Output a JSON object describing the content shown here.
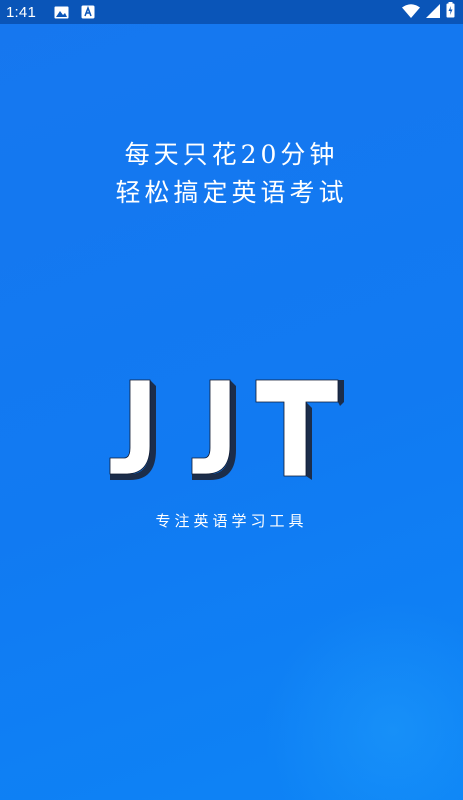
{
  "status_bar": {
    "time": "1:41",
    "icons": [
      "image-icon",
      "font-a-icon",
      "wifi-icon",
      "cell-signal-icon",
      "battery-icon"
    ],
    "background": "#0a55b8"
  },
  "slogan": {
    "line1": "每天只花20分钟",
    "line2": "轻松搞定英语考试"
  },
  "logo": {
    "text": "JJT",
    "face_color": "#ffffff",
    "side_color": "#1c2d4a"
  },
  "tagline": "专注英语学习工具",
  "colors": {
    "background_primary": "#1677ef",
    "background_secondary": "#0d84f6",
    "text": "#ffffff"
  }
}
